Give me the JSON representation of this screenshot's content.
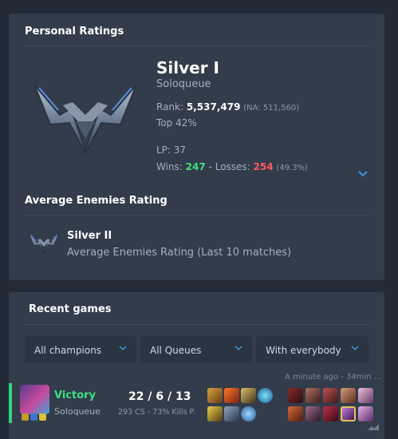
{
  "personal_ratings": {
    "title": "Personal Ratings",
    "tier": "Silver I",
    "queue": "Soloqueue",
    "rank_label": "Rank:",
    "rank_value": "5,537,479",
    "rank_region": "(NA: 511,560)",
    "top_percent": "Top 42%",
    "lp": "LP: 37",
    "wins_label": "Wins:",
    "wins_value": "247",
    "sep": "-",
    "losses_label": "Losses:",
    "losses_value": "254",
    "winrate": "(49.3%)",
    "expand_icon": "chevron-down-icon"
  },
  "average_enemies": {
    "title": "Average Enemies Rating",
    "tier": "Silver II",
    "description": "Average Enemies Rating (Last 10 matches)"
  },
  "recent_games": {
    "title": "Recent games",
    "filters": [
      {
        "label": "All champions"
      },
      {
        "label": "All Queues"
      },
      {
        "label": "With everybody"
      }
    ],
    "match": {
      "time": "A minute ago - 34min ...",
      "result": "Victory",
      "queue": "Soloqueue",
      "kda": "22 / 6 / 13",
      "stats": "293 CS - 73% Kills P.",
      "colors": {
        "result": "#3fe07f",
        "stripe": "#2fd57a"
      }
    }
  }
}
